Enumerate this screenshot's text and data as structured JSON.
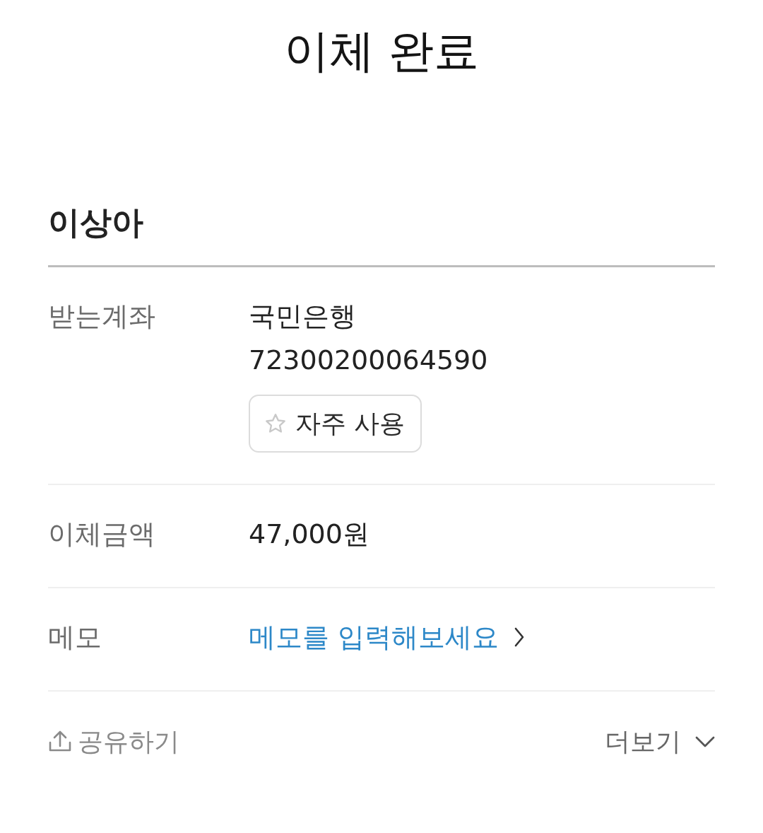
{
  "header": {
    "title": "이체 완료"
  },
  "recipient": {
    "name": "이상아"
  },
  "details": [
    {
      "kind": "account",
      "label": "받는계좌",
      "bank": "국민은행",
      "account_number": "72300200064590",
      "favorite_button": {
        "label": "자주 사용",
        "starred": false
      }
    },
    {
      "kind": "amount",
      "label": "이체금액",
      "value": "47,000원"
    },
    {
      "kind": "memo",
      "label": "메모",
      "action": "메모를 입력해보세요"
    }
  ],
  "footer": {
    "share": "공유하기",
    "more": "더보기"
  }
}
